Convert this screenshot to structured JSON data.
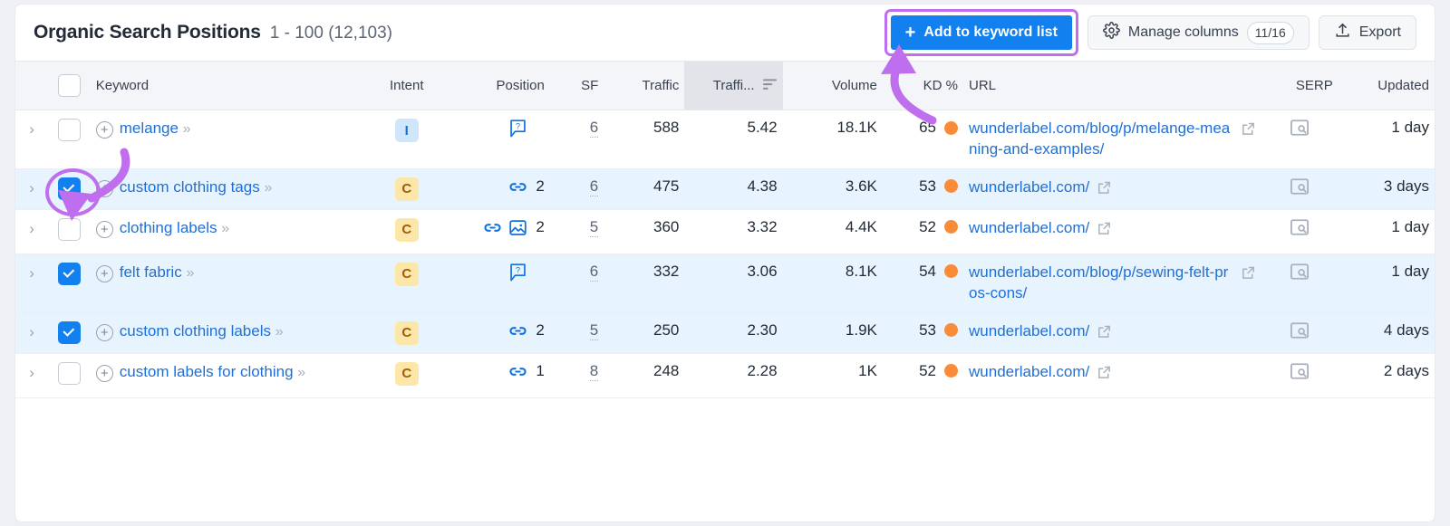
{
  "header": {
    "title": "Organic Search Positions",
    "range": "1 - 100 (12,103)",
    "add_button": "Add to keyword list",
    "add_button_icon": "plus-icon",
    "manage_columns": "Manage columns",
    "manage_columns_count": "11/16",
    "manage_columns_icon": "gear-icon",
    "export": "Export",
    "export_icon": "upload-icon"
  },
  "table": {
    "columns": [
      {
        "key": "expand",
        "label": ""
      },
      {
        "key": "select",
        "label": ""
      },
      {
        "key": "keyword",
        "label": "Keyword"
      },
      {
        "key": "intent",
        "label": "Intent"
      },
      {
        "key": "position",
        "label": "Position"
      },
      {
        "key": "sf",
        "label": "SF"
      },
      {
        "key": "traffic",
        "label": "Traffic"
      },
      {
        "key": "traffic_pct",
        "label": "Traffi...",
        "sorted": true,
        "sort_icon": "sort-desc-icon"
      },
      {
        "key": "volume",
        "label": "Volume"
      },
      {
        "key": "kd",
        "label": "KD %"
      },
      {
        "key": "url",
        "label": "URL"
      },
      {
        "key": "serp",
        "label": "SERP"
      },
      {
        "key": "updated",
        "label": "Updated"
      }
    ],
    "rows": [
      {
        "selected": false,
        "highlighted": false,
        "keyword": "melange",
        "intent": "I",
        "position_icons": [
          "question-bubble-icon"
        ],
        "position": "",
        "sf": "6",
        "traffic": "588",
        "traffic_pct": "5.42",
        "volume": "18.1K",
        "kd": "65",
        "url": "wunderlabel.com/blog/p/melange-meaning-and-examples/",
        "updated": "1 day"
      },
      {
        "selected": true,
        "highlighted": true,
        "annotated": true,
        "keyword": "custom clothing tags",
        "intent": "C",
        "position_icons": [
          "link-icon"
        ],
        "position": "2",
        "sf": "6",
        "traffic": "475",
        "traffic_pct": "4.38",
        "volume": "3.6K",
        "kd": "53",
        "url": "wunderlabel.com/",
        "updated": "3 days"
      },
      {
        "selected": false,
        "highlighted": false,
        "keyword": "clothing labels",
        "intent": "C",
        "position_icons": [
          "link-icon",
          "image-icon"
        ],
        "position": "2",
        "sf": "5",
        "traffic": "360",
        "traffic_pct": "3.32",
        "volume": "4.4K",
        "kd": "52",
        "url": "wunderlabel.com/",
        "updated": "1 day"
      },
      {
        "selected": true,
        "highlighted": true,
        "keyword": "felt fabric",
        "intent": "C",
        "position_icons": [
          "question-bubble-icon"
        ],
        "position": "",
        "sf": "6",
        "traffic": "332",
        "traffic_pct": "3.06",
        "volume": "8.1K",
        "kd": "54",
        "url": "wunderlabel.com/blog/p/sewing-felt-pros-cons/",
        "updated": "1 day"
      },
      {
        "selected": true,
        "highlighted": true,
        "keyword": "custom clothing labels",
        "intent": "C",
        "position_icons": [
          "link-icon"
        ],
        "position": "2",
        "sf": "5",
        "traffic": "250",
        "traffic_pct": "2.30",
        "volume": "1.9K",
        "kd": "53",
        "url": "wunderlabel.com/",
        "updated": "4 days"
      },
      {
        "selected": false,
        "highlighted": false,
        "keyword": "custom labels for clothing",
        "intent": "C",
        "position_icons": [
          "link-icon"
        ],
        "position": "1",
        "sf": "8",
        "traffic": "248",
        "traffic_pct": "2.28",
        "volume": "1K",
        "kd": "52",
        "url": "wunderlabel.com/",
        "updated": "2 days"
      }
    ]
  },
  "annotations": {
    "color": "#bf6fee",
    "arrow_to_checkbox": "curved-arrow-down-icon",
    "arrow_to_add_button": "curved-arrow-up-icon",
    "highlight_ring": "ellipse-highlight"
  },
  "colors": {
    "accent_blue": "#1280ef",
    "link_blue": "#1f6fd6",
    "annotation_purple": "#bf6fee",
    "kd_orange": "#fa8b38",
    "intent_informational_bg": "#cfe6fb",
    "intent_commercial_bg": "#fde7a8",
    "row_highlight": "#e8f4fd"
  }
}
